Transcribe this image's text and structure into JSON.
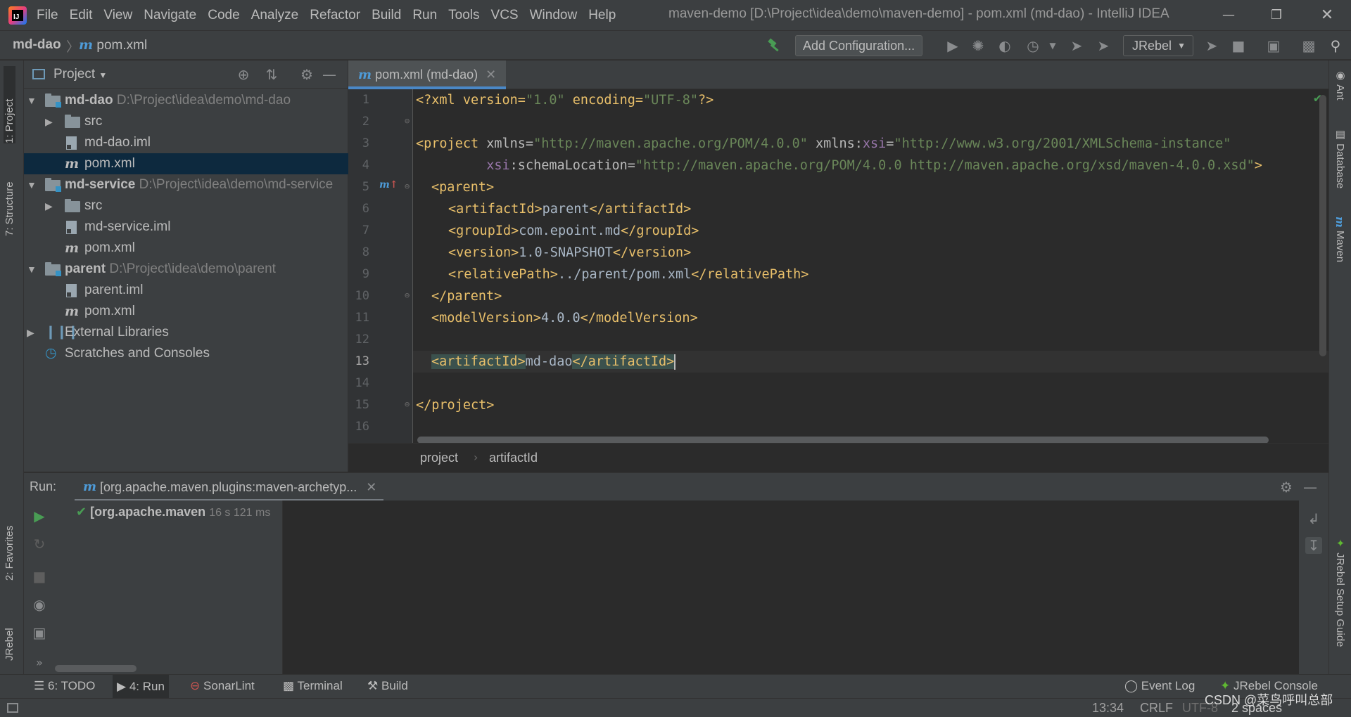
{
  "app": {
    "window_title": "maven-demo [D:\\Project\\idea\\demo\\maven-demo] - pom.xml (md-dao) - IntelliJ IDEA",
    "logo_text": "IJ"
  },
  "menu": [
    "File",
    "Edit",
    "View",
    "Navigate",
    "Code",
    "Analyze",
    "Refactor",
    "Build",
    "Run",
    "Tools",
    "VCS",
    "Window",
    "Help"
  ],
  "navbar": {
    "module": "md-dao",
    "file": "pom.xml",
    "add_configuration": "Add Configuration...",
    "jrebel_select": "JRebel"
  },
  "left_stripe": {
    "project_tab": "1: Project",
    "structure_tab": "7: Structure",
    "favorites_tab": "2: Favorites",
    "jrebel_tab": "JRebel"
  },
  "right_stripe": {
    "ant_tab": "Ant",
    "database_tab": "Database",
    "maven_tab": "Maven",
    "jrebel_guide_tab": "JRebel Setup Guide"
  },
  "project_panel": {
    "title": "Project",
    "tree": [
      {
        "label": "md-dao",
        "path": "D:\\Project\\idea\\demo\\md-dao",
        "kind": "module",
        "indent": 0,
        "expanded": true
      },
      {
        "label": "src",
        "path": "",
        "kind": "folder",
        "indent": 1,
        "expanded": false
      },
      {
        "label": "md-dao.iml",
        "path": "",
        "kind": "iml",
        "indent": 1
      },
      {
        "label": "pom.xml",
        "path": "",
        "kind": "pom",
        "indent": 1,
        "selected": true
      },
      {
        "label": "md-service",
        "path": "D:\\Project\\idea\\demo\\md-service",
        "kind": "module",
        "indent": 0,
        "expanded": true
      },
      {
        "label": "src",
        "path": "",
        "kind": "folder",
        "indent": 1,
        "expanded": false
      },
      {
        "label": "md-service.iml",
        "path": "",
        "kind": "iml",
        "indent": 1
      },
      {
        "label": "pom.xml",
        "path": "",
        "kind": "pom",
        "indent": 1
      },
      {
        "label": "parent",
        "path": "D:\\Project\\idea\\demo\\parent",
        "kind": "module",
        "indent": 0,
        "expanded": true
      },
      {
        "label": "parent.iml",
        "path": "",
        "kind": "iml",
        "indent": 1
      },
      {
        "label": "pom.xml",
        "path": "",
        "kind": "pom",
        "indent": 1
      },
      {
        "label": "External Libraries",
        "path": "",
        "kind": "libraries",
        "indent": 0,
        "expanded": false
      },
      {
        "label": "Scratches and Consoles",
        "path": "",
        "kind": "scratches",
        "indent": 0
      }
    ]
  },
  "editor": {
    "tab_label": "pom.xml (md-dao)",
    "line_numbers": [
      "1",
      "2",
      "3",
      "4",
      "5",
      "6",
      "7",
      "8",
      "9",
      "10",
      "11",
      "12",
      "13",
      "14",
      "15",
      "16"
    ],
    "current_line": 13,
    "code": {
      "l1": {
        "a": "<?xml version=",
        "b": "\"1.0\"",
        "c": " encoding=",
        "d": "\"UTF-8\"",
        "e": "?>"
      },
      "l3": {
        "a": "<project",
        "b": " xmlns=",
        "c": "\"http://maven.apache.org/POM/4.0.0\"",
        "d": " xmlns:",
        "e": "xsi",
        "f": "=",
        "g": "\"http://www.w3.org/2001/XMLSchema-instance\""
      },
      "l4": {
        "a": "         ",
        "b": "xsi",
        "c": ":schemaLocation=",
        "d": "\"http://maven.apache.org/POM/4.0.0 http://maven.apache.org/xsd/maven-4.0.0.xsd\"",
        "e": ">"
      },
      "l5": {
        "a": "<parent>"
      },
      "l6": {
        "a": "<artifactId>",
        "b": "parent",
        "c": "</artifactId>"
      },
      "l7": {
        "a": "<groupId>",
        "b": "com.epoint.md",
        "c": "</groupId>"
      },
      "l8": {
        "a": "<version>",
        "b": "1.0-SNAPSHOT",
        "c": "</version>"
      },
      "l9": {
        "a": "<relativePath>",
        "b": "../parent/pom.xml",
        "c": "</relativePath>"
      },
      "l10": {
        "a": "</parent>"
      },
      "l11": {
        "a": "<modelVersion>",
        "b": "4.0.0",
        "c": "</modelVersion>"
      },
      "l13": {
        "a": "<artifactId>",
        "b": "md-dao",
        "c": "</artifactId>"
      },
      "l15": {
        "a": "</project>"
      }
    },
    "breadcrumb": [
      "project",
      "artifactId"
    ]
  },
  "run_panel": {
    "label": "Run:",
    "tab": "[org.apache.maven.plugins:maven-archetyp...",
    "tree_item": "[org.apache.maven",
    "tree_time": "16 s 121 ms"
  },
  "tool_tabs": {
    "todo": "6: TODO",
    "run": "4: Run",
    "sonarlint": "SonarLint",
    "terminal": "Terminal",
    "build": "Build",
    "event_log": "Event Log",
    "jrebel_console": "JRebel Console"
  },
  "status_bar": {
    "position": "13:34",
    "line_sep": "CRLF",
    "encoding": "UTF-8",
    "indent": "2 spaces",
    "watermark": "CSDN @菜鸟呼叫总部"
  },
  "colors": {
    "accent": "#4a88c7",
    "tag": "#e8bf6a",
    "string": "#6a8759",
    "namespace": "#9876aa",
    "success": "#499c54"
  }
}
